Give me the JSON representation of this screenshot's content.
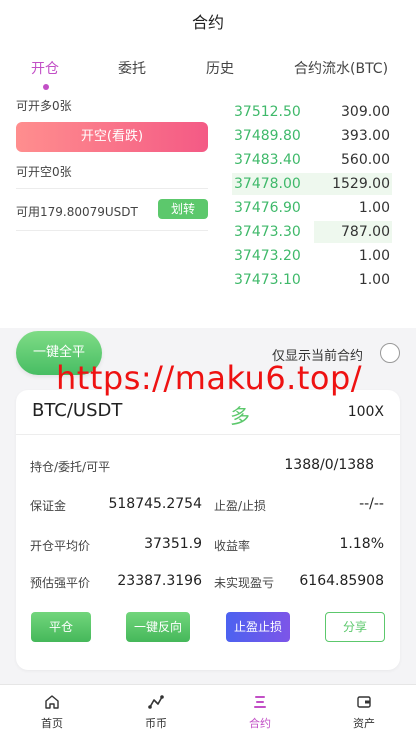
{
  "header": {
    "title": "合约"
  },
  "tabs": [
    {
      "label": "开仓",
      "active": true
    },
    {
      "label": "委托"
    },
    {
      "label": "历史"
    },
    {
      "label": "合约流水(BTC)"
    }
  ],
  "trade": {
    "can_open_long": "可开多0张",
    "short_button": "开空(看跌)",
    "can_open_short": "可开空0张",
    "available": "可用179.80079USDT",
    "transfer_button": "划转"
  },
  "order_book": [
    {
      "price": "37512.50",
      "qty": "309.00",
      "depth": 0
    },
    {
      "price": "37489.80",
      "qty": "393.00",
      "depth": 0
    },
    {
      "price": "37483.40",
      "qty": "560.00",
      "depth": 0
    },
    {
      "price": "37478.00",
      "qty": "1529.00",
      "depth": 1.0
    },
    {
      "price": "37476.90",
      "qty": "1.00",
      "depth": 0
    },
    {
      "price": "37473.30",
      "qty": "787.00",
      "depth": 0.49
    },
    {
      "price": "37473.20",
      "qty": "1.00",
      "depth": 0
    },
    {
      "price": "37473.10",
      "qty": "1.00",
      "depth": 0
    }
  ],
  "close_all_button": "一键全平",
  "only_current_label": "仅显示当前合约",
  "watermark": "https://maku6.top/",
  "position": {
    "pair": "BTC/USDT",
    "direction": "多",
    "leverage": "100X",
    "hold_label": "持仓/委托/可平",
    "hold_value": "1388/0/1388",
    "margin_label": "保证金",
    "margin_value": "518745.2754",
    "tpsl_label": "止盈/止损",
    "tpsl_value": "--/--",
    "avg_label": "开仓平均价",
    "avg_value": "37351.9",
    "yield_label": "收益率",
    "yield_value": "1.18%",
    "liq_label": "预估强平价",
    "liq_value": "23387.3196",
    "pnl_label": "未实现盈亏",
    "pnl_value": "6164.85908",
    "btn_close": "平仓",
    "btn_reverse": "一键反向",
    "btn_tpsl": "止盈止损",
    "btn_share": "分享"
  },
  "tabbar": [
    {
      "label": "首页",
      "icon": "home-icon"
    },
    {
      "label": "币币",
      "icon": "exchange-icon"
    },
    {
      "label": "合约",
      "icon": "contract-icon",
      "active": true
    },
    {
      "label": "资产",
      "icon": "wallet-icon"
    }
  ],
  "colors": {
    "accent": "#c24fc6",
    "green": "#5cc86c",
    "red": "#f45a85",
    "blue": "#4c62f0"
  }
}
